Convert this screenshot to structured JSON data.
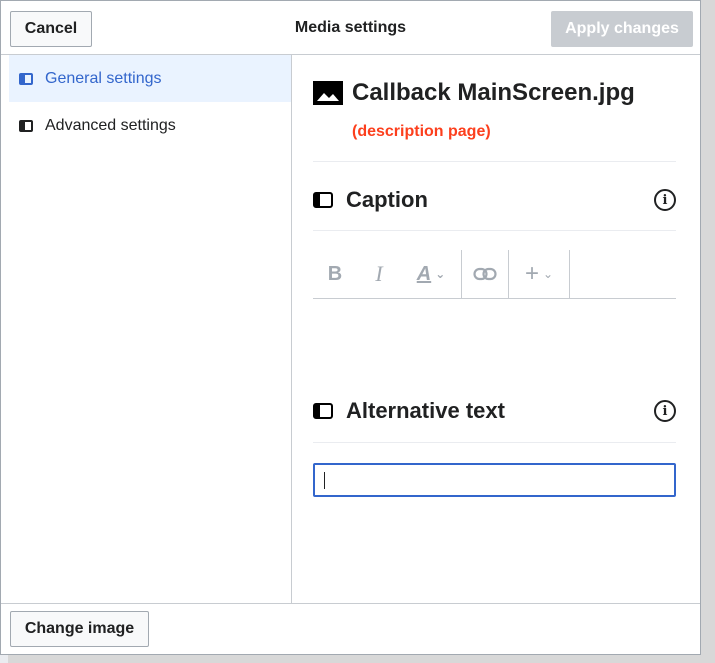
{
  "dialog": {
    "title": "Media settings",
    "cancel_label": "Cancel",
    "apply_label": "Apply changes"
  },
  "sidebar": {
    "items": [
      {
        "label": "General settings",
        "active": true
      },
      {
        "label": "Advanced settings",
        "active": false
      }
    ]
  },
  "media": {
    "file_name": "Callback MainScreen.jpg",
    "description_link": "(description page)"
  },
  "caption": {
    "title": "Caption",
    "toolbar": {
      "bold": "B",
      "italic": "I",
      "style": "A",
      "insert": "+"
    }
  },
  "alt_text": {
    "title": "Alternative text",
    "value": ""
  },
  "footer": {
    "change_image_label": "Change image"
  },
  "icons": {
    "image": "image-icon",
    "section": "section-icon",
    "info": "info-icon",
    "link": "link-icon",
    "chevron": "chevron-down-icon"
  },
  "colors": {
    "accent": "#3366cc",
    "link_red": "#fc3f1d",
    "disabled_button": "#c8ccd1"
  }
}
